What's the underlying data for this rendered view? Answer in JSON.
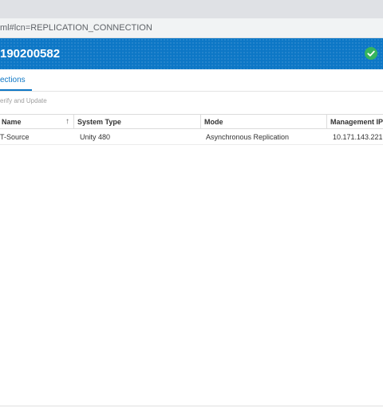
{
  "browser": {
    "url": "ml#lcn=REPLICATION_CONNECTION"
  },
  "header": {
    "title": "190200582",
    "status_icon": "check-circle-icon",
    "accent_color": "#0d77c6",
    "status_color": "#36b45e"
  },
  "tabs": [
    {
      "label": "ections",
      "active": true
    }
  ],
  "toolbar": {
    "action_label": "erify and Update"
  },
  "table": {
    "columns": [
      {
        "label": "Name",
        "sorted": "ascending"
      },
      {
        "label": "System Type"
      },
      {
        "label": "Mode"
      },
      {
        "label": "Management IP A"
      }
    ],
    "rows": [
      {
        "name": "T-Source",
        "system_type": "Unity 480",
        "mode": "Asynchronous Replication",
        "management_ip": "10.171.143.221"
      }
    ]
  }
}
